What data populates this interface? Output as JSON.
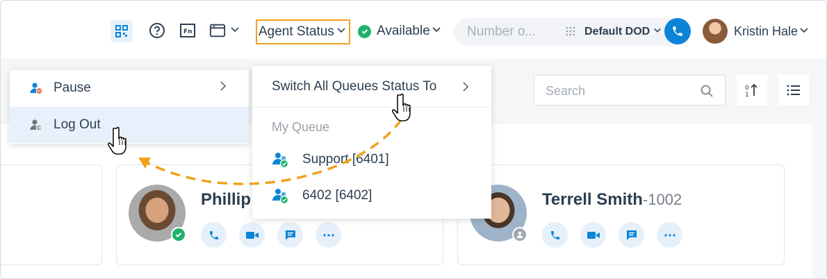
{
  "topbar": {
    "agent_status_label": "Agent Status",
    "availability_label": "Available",
    "number_placeholder": "Number o...",
    "dod_label": "Default DOD",
    "user_name": "Kristin Hale"
  },
  "toolbar": {
    "search_placeholder": "Search"
  },
  "status_menu": {
    "items": [
      {
        "label": "Pause",
        "has_submenu": true
      },
      {
        "label": "Log Out",
        "highlighted": true
      }
    ]
  },
  "queue_menu": {
    "switch_all_label": "Switch All Queues Status To",
    "section_label": "My Queue",
    "queues": [
      {
        "label": "Support [6401]",
        "status": "available"
      },
      {
        "label": "6402 [6402]",
        "status": "available"
      }
    ]
  },
  "contacts": [
    {
      "name": "Phillip",
      "ext": "",
      "status": "available"
    },
    {
      "name": "Terrell Smith",
      "ext": "-1002",
      "status": "offline"
    }
  ],
  "colors": {
    "accent": "#0b84d8",
    "highlight_border": "#f0a21a",
    "available": "#1fb26a",
    "annotation_arrow": "#f0a21a"
  }
}
